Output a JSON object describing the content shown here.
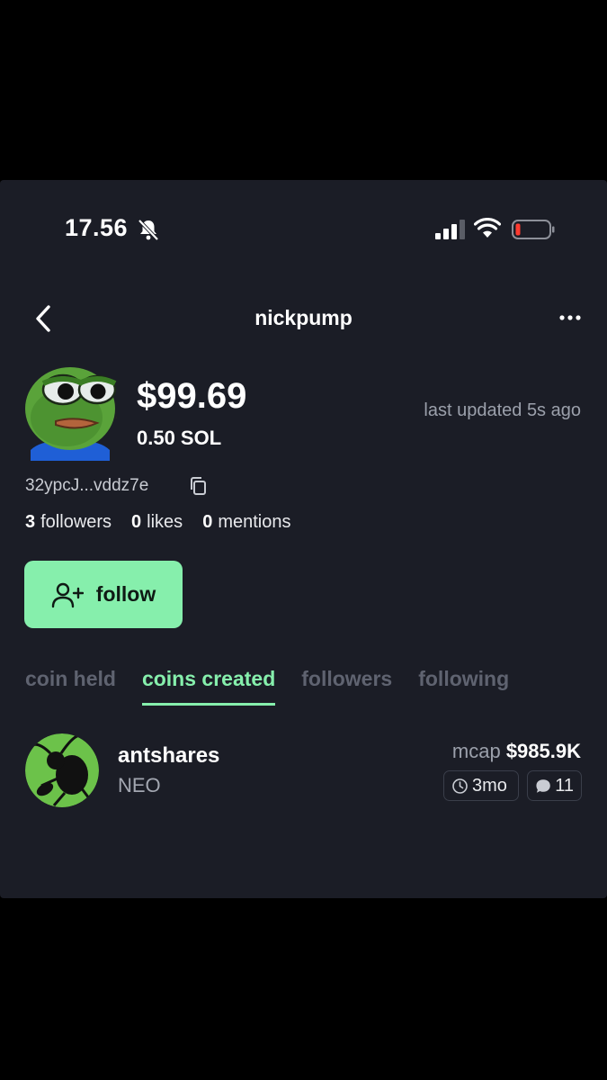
{
  "status_bar": {
    "time": "17.56"
  },
  "header": {
    "title": "nickpump"
  },
  "profile": {
    "balance_usd": "$99.69",
    "balance_sol": "0.50 SOL",
    "last_updated": "last updated 5s ago",
    "address": "32ypcJ...vddz7e",
    "stats": {
      "followers_count": "3",
      "followers_label": "followers",
      "likes_count": "0",
      "likes_label": "likes",
      "mentions_count": "0",
      "mentions_label": "mentions"
    },
    "follow_label": "follow"
  },
  "tabs": [
    {
      "label": "coin held",
      "active": false
    },
    {
      "label": "coins created",
      "active": true
    },
    {
      "label": "followers",
      "active": false
    },
    {
      "label": "following",
      "active": false
    }
  ],
  "coins": [
    {
      "name": "antshares",
      "ticker": "NEO",
      "mcap_label": "mcap",
      "mcap_value": "$985.9K",
      "age": "3mo",
      "replies": "11"
    }
  ],
  "colors": {
    "background": "#1b1d26",
    "accent": "#86efac",
    "muted": "#9ba0ab"
  }
}
